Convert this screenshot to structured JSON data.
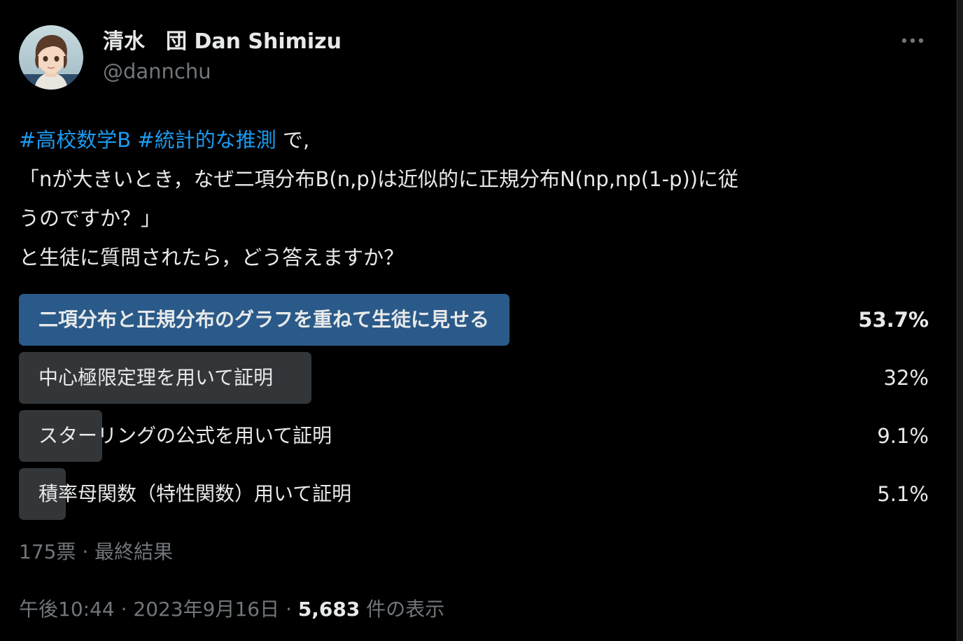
{
  "author": {
    "display_name": "清水　団 Dan Shimizu",
    "handle": "@dannchu",
    "avatar_icon": "avatar-illustration-icon"
  },
  "more_icon": "more-dots-icon",
  "tweet": {
    "hashtag1": "#高校数学B",
    "hashtag2": "#統計的な推測",
    "line1_tail": " で,",
    "line2": "「nが大きいとき，なぜ二項分布B(n,p)は近似的に正規分布N(np,np(1-p))に従",
    "line3": "うのですか？」",
    "line4": "と生徒に質問されたら，どう答えますか？"
  },
  "poll": {
    "options": [
      {
        "label": "二項分布と正規分布のグラフを重ねて生徒に見せる",
        "percent_text": "53.7%",
        "percent": 53.7
      },
      {
        "label": "中心極限定理を用いて証明",
        "percent_text": "32%",
        "percent": 32
      },
      {
        "label": "スターリングの公式を用いて証明",
        "percent_text": "9.1%",
        "percent": 9.1
      },
      {
        "label": "積率母関数（特性関数）用いて証明",
        "percent_text": "5.1%",
        "percent": 5.1
      }
    ],
    "votes": "175票",
    "separator": " · ",
    "status": "最終結果"
  },
  "footer": {
    "time": "午後10:44",
    "separator": " · ",
    "date": "2023年9月16日",
    "views_count": "5,683",
    "views_label": " 件の表示"
  },
  "colors": {
    "background": "#000000",
    "text": "#e7e9ea",
    "muted": "#71767b",
    "hashtag": "#1d9bf0",
    "winner_bar": "#2a5a89",
    "other_bar": "#333639"
  }
}
